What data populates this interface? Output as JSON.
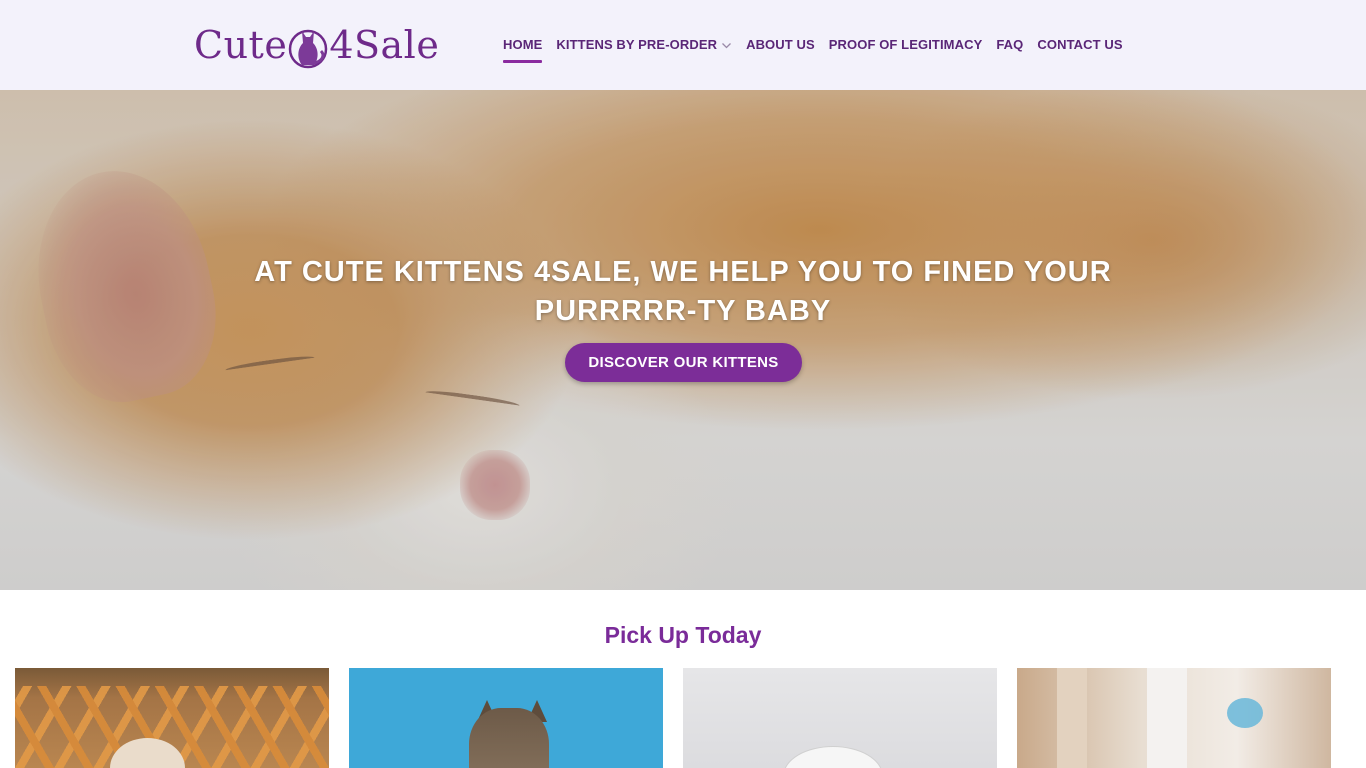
{
  "header": {
    "logo_text_left": "Cute",
    "logo_text_right": "4Sale",
    "nav": [
      {
        "label": "Home",
        "active": true
      },
      {
        "label": "Kittens by Pre-Order",
        "has_dropdown": true
      },
      {
        "label": "About Us"
      },
      {
        "label": "Proof of Legitimacy"
      },
      {
        "label": "FAQ"
      },
      {
        "label": "Contact Us"
      }
    ]
  },
  "hero": {
    "title": "AT CUTE KITTENS 4SALE, WE HELP YOU TO FINED YOUR PURRRRR-TY BABY",
    "button": "Discover Our Kittens"
  },
  "section": {
    "title": "Pick Up Today"
  },
  "colors": {
    "brand": "#7c2d98",
    "nav_text": "#5a2677",
    "header_bg": "#f3f2fb"
  }
}
